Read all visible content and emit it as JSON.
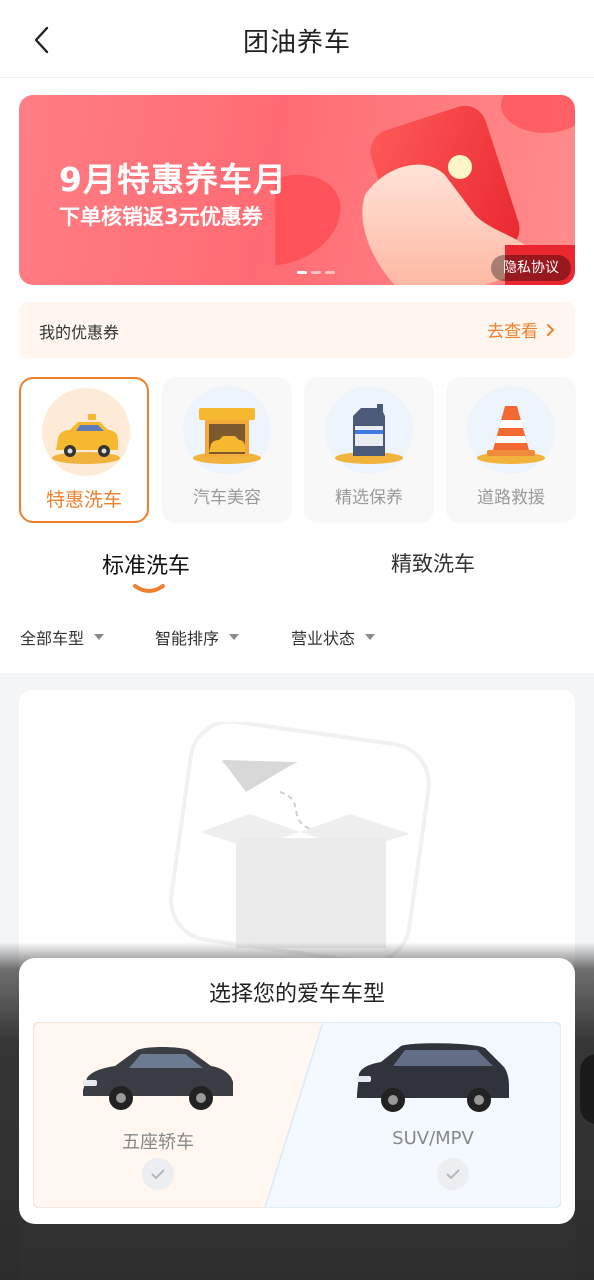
{
  "header": {
    "title": "团油养车"
  },
  "banner": {
    "title": "9月特惠养车月",
    "subtitle": "下单核销返3元优惠券",
    "privacy_label": "隐私协议",
    "accent": "#ff6b73"
  },
  "coupon": {
    "label": "我的优惠券",
    "link": "去查看"
  },
  "services": [
    {
      "label": "特惠洗车",
      "icon": "car-wash-icon",
      "active": true
    },
    {
      "label": "汽车美容",
      "icon": "car-beauty-icon",
      "active": false
    },
    {
      "label": "精选保养",
      "icon": "engine-oil-icon",
      "active": false
    },
    {
      "label": "道路救援",
      "icon": "traffic-cone-icon",
      "active": false
    }
  ],
  "tabs": [
    {
      "label": "标准洗车",
      "active": true
    },
    {
      "label": "精致洗车",
      "active": false
    }
  ],
  "filters": [
    {
      "label": "全部车型"
    },
    {
      "label": "智能排序"
    },
    {
      "label": "营业状态"
    }
  ],
  "modal": {
    "title": "选择您的爱车车型",
    "options": [
      {
        "label": "五座轿车",
        "icon": "sedan-icon"
      },
      {
        "label": "SUV/MPV",
        "icon": "suv-icon"
      }
    ]
  },
  "colors": {
    "accent": "#f07f2e",
    "coupon_bg": "#fff7ef"
  }
}
